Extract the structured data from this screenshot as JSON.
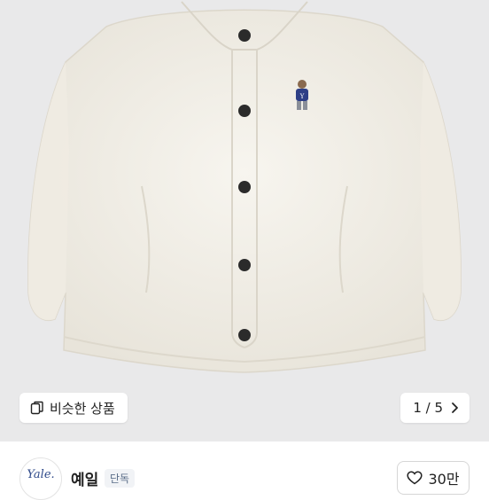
{
  "gallery": {
    "similar_label": "비슷한 상품",
    "counter_label": "1 / 5",
    "similar_icon": "copy-icon",
    "counter_icon": "chevron-right-icon"
  },
  "seller": {
    "avatar_text": "Yale.",
    "name": "예일",
    "badge": "단독",
    "likes": "30만",
    "like_icon": "heart-icon"
  },
  "colors": {
    "gallery_bg": "#e9e9ea",
    "fleece": "#f4f1ea",
    "button": "#2b2b2b",
    "badge_text": "#5a6d88"
  }
}
